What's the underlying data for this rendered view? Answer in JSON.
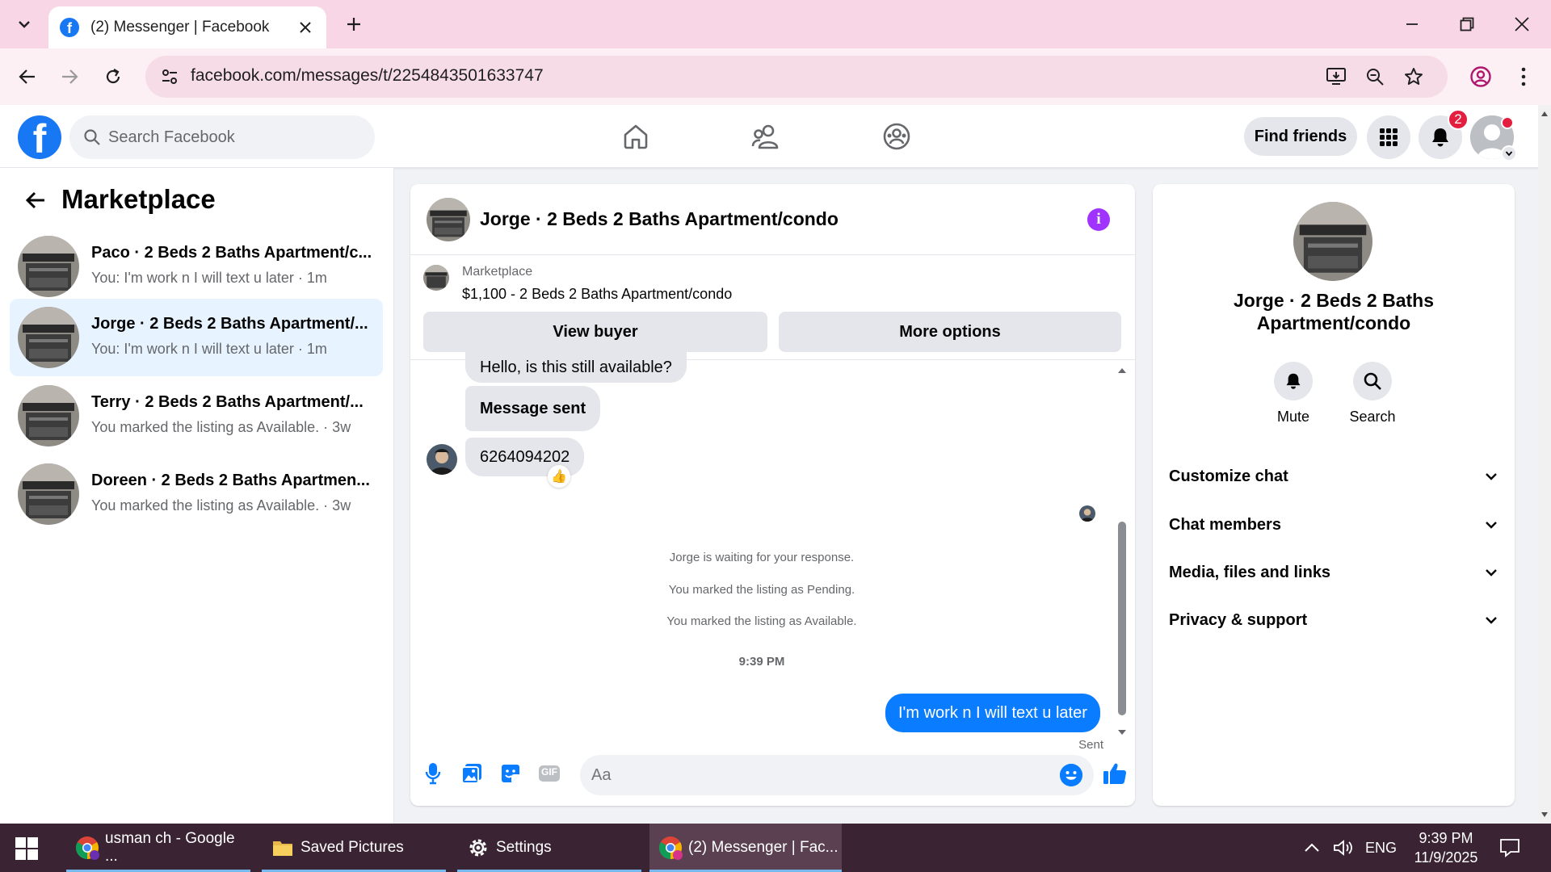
{
  "browser": {
    "tab_title": "(2) Messenger | Facebook",
    "url": "facebook.com/messages/t/2254843501633747"
  },
  "fb": {
    "search_placeholder": "Search Facebook",
    "find_friends": "Find friends",
    "notification_count": "2"
  },
  "left": {
    "title": "Marketplace",
    "conversations": [
      {
        "name": "Paco · 2 Beds 2 Baths Apartment/c...",
        "snippet": "You: I'm work n I will text u later · 1m"
      },
      {
        "name": "Jorge · 2 Beds 2 Baths Apartment/...",
        "snippet": "You: I'm work n I will text u later · 1m"
      },
      {
        "name": "Terry · 2 Beds 2 Baths Apartment/...",
        "snippet": "You marked the listing as Available. · 3w"
      },
      {
        "name": "Doreen · 2 Beds 2 Baths Apartmen...",
        "snippet": "You marked the listing as Available. · 3w"
      }
    ]
  },
  "chat": {
    "title": "Jorge · 2 Beds 2 Baths Apartment/condo",
    "listing_label": "Marketplace",
    "listing_price": "$1,100 - 2 Beds 2 Baths Apartment/condo",
    "view_buyer": "View buyer",
    "more_options": "More options",
    "messages": {
      "m1": "Hello, is this still available?",
      "m2": "Message sent",
      "m3": "6264094202",
      "reaction": "👍",
      "sys1": "Jorge is waiting for your response.",
      "sys2": "You marked the listing as Pending.",
      "sys3": "You marked the listing as Available.",
      "time": "9:39 PM",
      "out": "I'm work n I will text u later",
      "status": "Sent"
    },
    "composer_placeholder": "Aa",
    "gif_label": "GIF"
  },
  "info": {
    "name": "Jorge · 2 Beds 2 Baths Apartment/condo",
    "mute": "Mute",
    "search": "Search",
    "sections": [
      "Customize chat",
      "Chat members",
      "Media, files and links",
      "Privacy & support"
    ]
  },
  "taskbar": {
    "items": [
      "usman ch - Google ...",
      "Saved Pictures",
      "Settings",
      "(2) Messenger | Fac..."
    ],
    "lang": "ENG",
    "time": "9:39 PM",
    "date": "11/9/2025"
  },
  "colors": {
    "accent": "#1877f2",
    "messenger_blue": "#0a7cff",
    "info_purple": "#a033ff",
    "badge_red": "#e41e3f",
    "tab_strip": "#f9d6e5"
  }
}
